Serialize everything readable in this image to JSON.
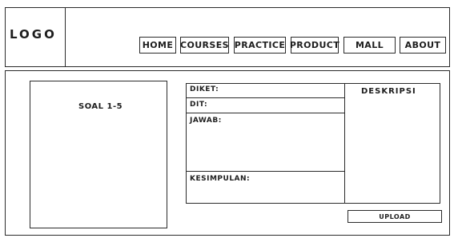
{
  "header": {
    "logo": "LOGO",
    "nav": [
      "HOME",
      "COURSES",
      "PRACTICE",
      "PRODUCT",
      "MALL",
      "ABOUT"
    ]
  },
  "content": {
    "question_panel": {
      "label": "SOAL 1-5"
    },
    "answer_form": {
      "diket_label": "DIKET:",
      "dit_label": "DIT:",
      "jawab_label": "JAWAB:",
      "kesimpulan_label": "KESIMPULAN:"
    },
    "description_panel": {
      "label": "DESKRIPSI"
    },
    "upload_button": "UPLOAD"
  }
}
